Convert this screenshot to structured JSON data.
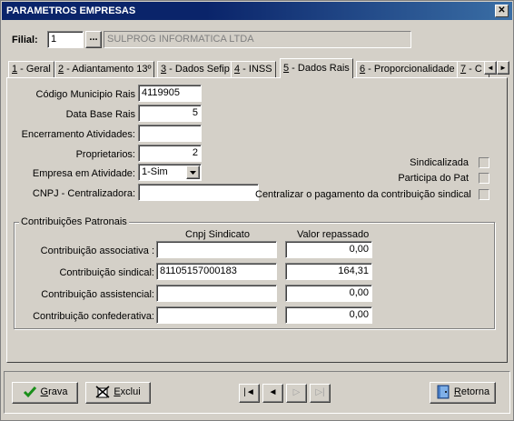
{
  "window": {
    "title": "PARAMETROS EMPRESAS",
    "close_glyph": "✕"
  },
  "filial": {
    "label": "Filial:",
    "value": "1",
    "lookup_label": "...",
    "company_name": "SULPROG INFORMATICA LTDA"
  },
  "tabs": [
    {
      "key": "1",
      "label": " - Geral"
    },
    {
      "key": "2",
      "label": " - Adiantamento 13º"
    },
    {
      "key": "3",
      "label": " - Dados Sefip"
    },
    {
      "key": "4",
      "label": " - INSS"
    },
    {
      "key": "5",
      "label": " - Dados Rais"
    },
    {
      "key": "6",
      "label": " - Proporcionalidade"
    },
    {
      "key": "7",
      "label": " - C"
    }
  ],
  "tab_scroll": {
    "left": "◄",
    "right": "►"
  },
  "rais": {
    "codigo_municipio": {
      "label": "Código Municipio Rais",
      "value": "4119905"
    },
    "data_base": {
      "label": "Data Base Rais",
      "value": "5"
    },
    "encerramento": {
      "label": "Encerramento Atividades:",
      "value": ""
    },
    "proprietarios": {
      "label": "Proprietarios:",
      "value": "2"
    },
    "empresa_atividade": {
      "label": "Empresa em Atividade:",
      "value": "1-Sim"
    },
    "cnpj_centralizadora": {
      "label": "CNPJ - Centralizadora:",
      "value": ""
    }
  },
  "checks": {
    "sindicalizada": "Sindicalizada",
    "participa_pat": "Participa do Pat",
    "centralizar": "Centralizar o pagamento da contribuição sindical"
  },
  "contribuicoes": {
    "title": "Contribuições Patronais",
    "col_cnpj": "Cnpj Sindicato",
    "col_valor": "Valor repassado",
    "rows": [
      {
        "label": "Contribuição associativa :",
        "cnpj": "",
        "valor": "0,00"
      },
      {
        "label": "Contribuição sindical:",
        "cnpj": "81105157000183",
        "valor": "164,31"
      },
      {
        "label": "Contribuição assistencial:",
        "cnpj": "",
        "valor": "0,00"
      },
      {
        "label": "Contribuição confederativa:",
        "cnpj": "",
        "valor": "0,00"
      }
    ]
  },
  "footer": {
    "grava": {
      "ul": "G",
      "rest": "rava"
    },
    "exclui": {
      "ul": "E",
      "rest": "xclui"
    },
    "retorna": {
      "ul": "R",
      "rest": "etorna"
    },
    "nav": {
      "first": "|◄",
      "prev": "◄",
      "next": "▷",
      "last": "▷|"
    }
  },
  "colors": {
    "title_bar": "#0a246a",
    "face": "#d4d0c8",
    "check_green": "#1a8f1a"
  }
}
